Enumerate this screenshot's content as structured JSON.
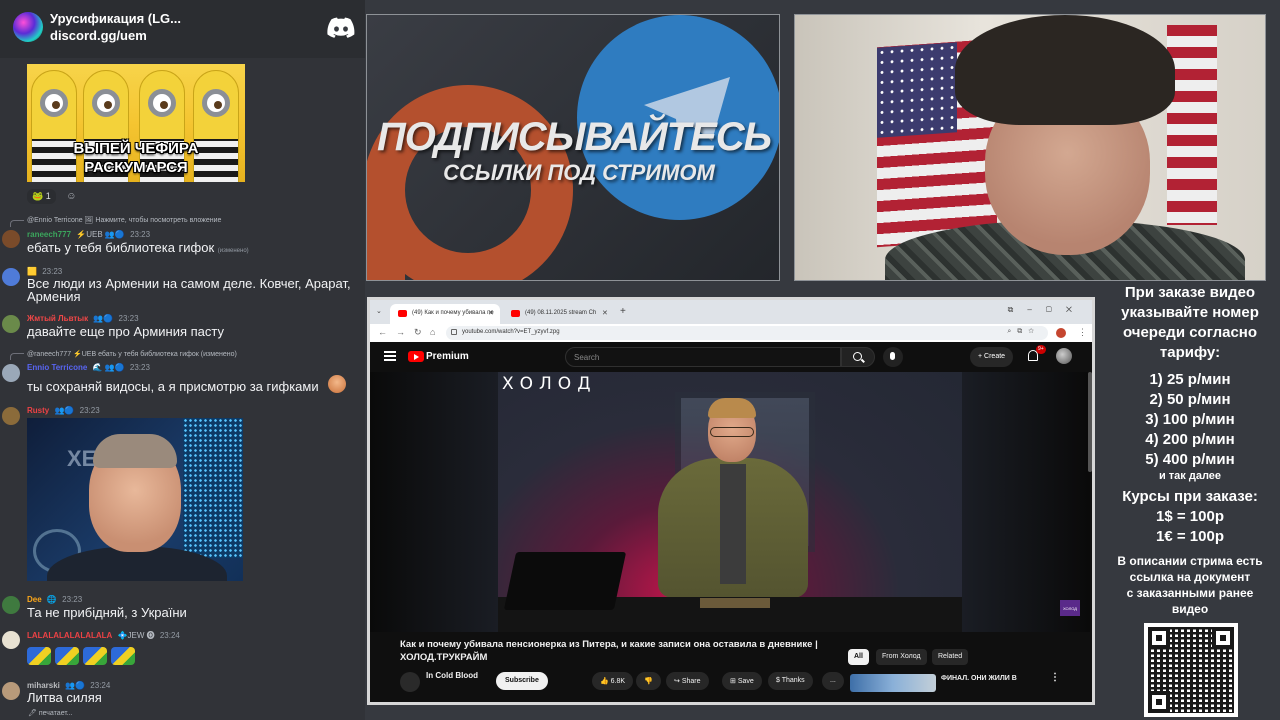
{
  "chat": {
    "server_name": "Урусификация (LG...",
    "server_link": "discord.gg/uem",
    "gif_minions": {
      "line1": "ВЫПЕЙ ЧЕФИРА",
      "line2": "РАСКУМАРСЯ"
    },
    "reaction_count": "1",
    "messages": [
      {
        "reply": "@Ennio Terricone 🖼 Нажмите, чтобы посмотреть вложение",
        "user": "raneech777",
        "user_color": "#3ba55c",
        "badge": "⚡UEB 👥🔵",
        "time": "23:23",
        "text": "ебать у тебя библиотека гифок",
        "edited": "(изменено)"
      },
      {
        "user": "",
        "badge": "🟨",
        "time": "23:23",
        "text": "Все люди из Армении на самом деле. Ковчег, Арарат, Армения"
      },
      {
        "user": "Жмтый Львтык",
        "user_color": "#f04747",
        "badge": "👥🔵",
        "time": "23:23",
        "text": "давайте еще про Арминия пасту"
      },
      {
        "reply": "@raneech777 ⚡UEB ебать у тебя библиотека гифок (изменено)",
        "user": "Ennio Terricone",
        "user_color": "#5865f2",
        "badge": "🌊 👥🔵",
        "time": "23:23",
        "text": "ты сохраняй видосы, а я присмотрю за гифками"
      },
      {
        "user": "Rusty",
        "user_color": "#ed4245",
        "badge": "👥🔵",
        "time": "23:23",
        "gif_text": "XE"
      },
      {
        "user": "Dee",
        "user_color": "#faa61a",
        "badge": "🌐",
        "time": "23:23",
        "text": "Та не прибідняй, з України"
      },
      {
        "user": "LALALALALALALALA",
        "user_color": "#ed4245",
        "badge": "💠JEW 🅞",
        "time": "23:24",
        "text": ""
      },
      {
        "user": "miharski",
        "user_color": "#b9bbbe",
        "badge": "👥🔵",
        "time": "23:24",
        "text": "Литва силяя"
      }
    ],
    "typing": "🖊 печатает..."
  },
  "promo": {
    "title": "ПОДПИСЫВАЙТЕСЬ",
    "subtitle": "ССЫЛКИ ПОД СТРИМОМ"
  },
  "browser": {
    "tabs": [
      {
        "label": "(49) Как и почему убивала пе"
      },
      {
        "label": "(49) 08.11.2025 stream Ch"
      }
    ],
    "url": "youtube.com/watch?v=ET_yzyvf.zpg",
    "youtube": {
      "brand": "Premium",
      "search_placeholder": "Search",
      "create_label": "Create",
      "notifications": "9+",
      "video_logo": "ХОЛОД",
      "watermark": "ХОЛОД",
      "title": "Как и почему убивала пенсионерка из Питера, и какие записи она оставила в дневнике | ХОЛОД.ТРУКРАЙМ",
      "channel": "In Cold Blood",
      "subscribe": "Subscribe",
      "likes": "6.8K",
      "share": "Share",
      "save": "Save",
      "thanks": "Thanks",
      "more": "...",
      "filters": [
        "All",
        "From Холод",
        "Related"
      ],
      "recommended_title": "ФИНАЛ. ОНИ ЖИЛИ В"
    }
  },
  "info": {
    "intro": [
      "При заказе видео",
      "указывайте номер",
      "очереди согласно",
      "тарифу:"
    ],
    "tariffs": [
      "1) 25 р/мин",
      "2) 50 р/мин",
      "3) 100 р/мин",
      "4) 200 р/мин",
      "5) 400 р/мин"
    ],
    "and_so_on": "и так далее",
    "rates_title": "Курсы при заказе:",
    "rates": [
      "1$ = 100р",
      "1€ = 100р"
    ],
    "description": [
      "В описании стрима есть",
      "ссылка на документ",
      "с заказанными ранее",
      "видео"
    ]
  }
}
